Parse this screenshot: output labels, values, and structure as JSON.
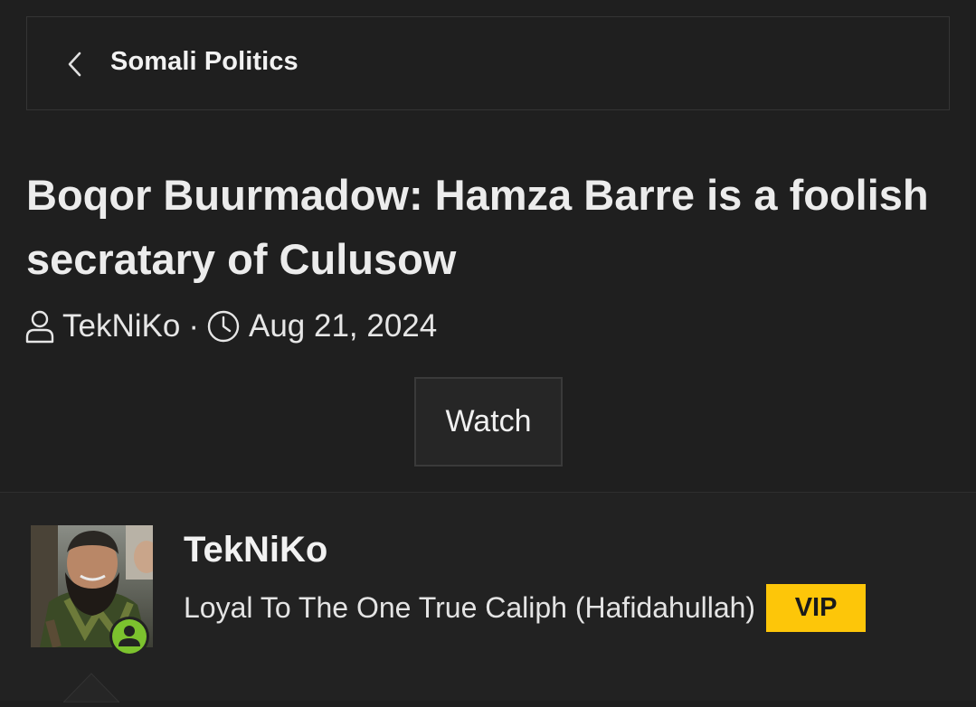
{
  "breadcrumb": {
    "label": "Somali Politics",
    "back_icon": "chevron-left-icon"
  },
  "thread": {
    "title": "Boqor Buurmadow: Hamza Barre is a foolish secratary of Culusow",
    "author": "TekNiKo",
    "separator": "·",
    "date": "Aug 21, 2024",
    "author_icon": "user-icon",
    "date_icon": "clock-icon"
  },
  "actions": {
    "watch_label": "Watch"
  },
  "post": {
    "username": "TekNiKo",
    "user_title": "Loyal To The One True Caliph (Hafidahullah)",
    "badge": "VIP",
    "online_icon": "online-user-icon"
  },
  "colors": {
    "background": "#1f1f1f",
    "vip_badge": "#fdc609",
    "online_indicator": "#7cc22e"
  }
}
